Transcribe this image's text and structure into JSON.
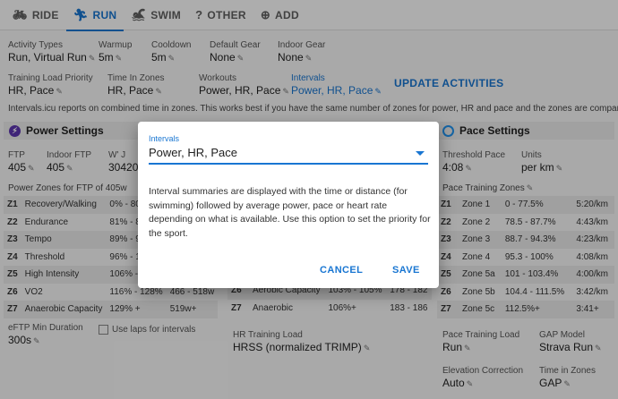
{
  "tabs": [
    {
      "label": "RIDE",
      "icon": "bike-icon"
    },
    {
      "label": "RUN",
      "icon": "runner-icon"
    },
    {
      "label": "SWIM",
      "icon": "swimmer-icon"
    },
    {
      "label": "OTHER",
      "icon": "help-circle-icon"
    },
    {
      "label": "ADD",
      "icon": "plus-circle-icon"
    }
  ],
  "settings": {
    "activity_types": {
      "label": "Activity Types",
      "value": "Run, Virtual Run"
    },
    "warmup": {
      "label": "Warmup",
      "value": "5m"
    },
    "cooldown": {
      "label": "Cooldown",
      "value": "5m"
    },
    "default_gear": {
      "label": "Default Gear",
      "value": "None"
    },
    "indoor_gear": {
      "label": "Indoor Gear",
      "value": "None"
    },
    "training_load_priority": {
      "label": "Training Load Priority",
      "value": "HR, Pace"
    },
    "time_in_zones": {
      "label": "Time In Zones",
      "value": "HR, Pace"
    },
    "workouts": {
      "label": "Workouts",
      "value": "Power, HR, Pace"
    },
    "intervals": {
      "label": "Intervals",
      "value": "Power, HR, Pace"
    },
    "update_button": "UPDATE ACTIVITIES",
    "info": "Intervals.icu reports on combined time in zones. This works best if you have the same number of zones for power, HR and pace and the zones are comparable."
  },
  "power": {
    "title": "Power Settings",
    "ftp": {
      "label": "FTP",
      "value": "405"
    },
    "indoor_ftp": {
      "label": "Indoor FTP",
      "value": "405"
    },
    "wprime": {
      "label": "W' J",
      "value": "30420"
    },
    "zones_title": "Power Zones for FTP of 405w",
    "zones": [
      {
        "z": "Z1",
        "name": "Recovery/Walking",
        "pct": "0% - 80",
        "watts": ""
      },
      {
        "z": "Z2",
        "name": "Endurance",
        "pct": "81% - 8",
        "watts": ""
      },
      {
        "z": "Z3",
        "name": "Tempo",
        "pct": "89% - 9",
        "watts": ""
      },
      {
        "z": "Z4",
        "name": "Threshold",
        "pct": "96% - 1",
        "watts": ""
      },
      {
        "z": "Z5",
        "name": "High Intensity",
        "pct": "106% - 1",
        "watts": ""
      },
      {
        "z": "Z6",
        "name": "VO2",
        "pct": "116% - 128%",
        "watts": "466 - 518w"
      },
      {
        "z": "Z7",
        "name": "Anaerobic Capacity",
        "pct": "129% +",
        "watts": "519w+"
      }
    ],
    "eftp": {
      "label": "eFTP Min Duration",
      "value": "300s"
    },
    "use_laps": "Use laps for intervals"
  },
  "hr": {
    "zones": [
      {
        "z": "Z6",
        "name": "Aerobic Capacity",
        "pct": "103% - 105%",
        "bpm": "178 - 182"
      },
      {
        "z": "Z7",
        "name": "Anaerobic",
        "pct": "106%+",
        "bpm": "183 - 186"
      }
    ],
    "training_load": {
      "label": "HR Training Load",
      "value": "HRSS (normalized TRIMP)"
    }
  },
  "pace": {
    "title": "Pace Settings",
    "threshold": {
      "label": "Threshold Pace",
      "value": "4:08"
    },
    "units": {
      "label": "Units",
      "value": "per km"
    },
    "zones_title": "Pace Training Zones",
    "zones": [
      {
        "z": "Z1",
        "name": "Zone 1",
        "pct": "0 - 77.5%",
        "pace": "5:20/km"
      },
      {
        "z": "Z2",
        "name": "Zone 2",
        "pct": "78.5 - 87.7%",
        "pace": "4:43/km"
      },
      {
        "z": "Z3",
        "name": "Zone 3",
        "pct": "88.7 - 94.3%",
        "pace": "4:23/km"
      },
      {
        "z": "Z4",
        "name": "Zone 4",
        "pct": "95.3 - 100%",
        "pace": "4:08/km"
      },
      {
        "z": "Z5",
        "name": "Zone 5a",
        "pct": "101 - 103.4%",
        "pace": "4:00/km"
      },
      {
        "z": "Z6",
        "name": "Zone 5b",
        "pct": "104.4 - 111.5%",
        "pace": "3:42/km"
      },
      {
        "z": "Z7",
        "name": "Zone 5c",
        "pct": "112.5%+",
        "pace": "3:41+"
      }
    ],
    "training_load": {
      "label": "Pace Training Load",
      "value": "Run"
    },
    "gap_model": {
      "label": "GAP Model",
      "value": "Strava Run"
    },
    "elevation": {
      "label": "Elevation Correction",
      "value": "Auto"
    },
    "time_in_zones": {
      "label": "Time in Zones",
      "value": "GAP"
    }
  },
  "dialog": {
    "field_label": "Intervals",
    "field_value": "Power, HR, Pace",
    "description": "Interval summaries are displayed with the time or distance (for swimming) followed by average power, pace or heart rate depending on what is available. Use this option to set the priority for the sport.",
    "cancel": "CANCEL",
    "save": "SAVE"
  }
}
